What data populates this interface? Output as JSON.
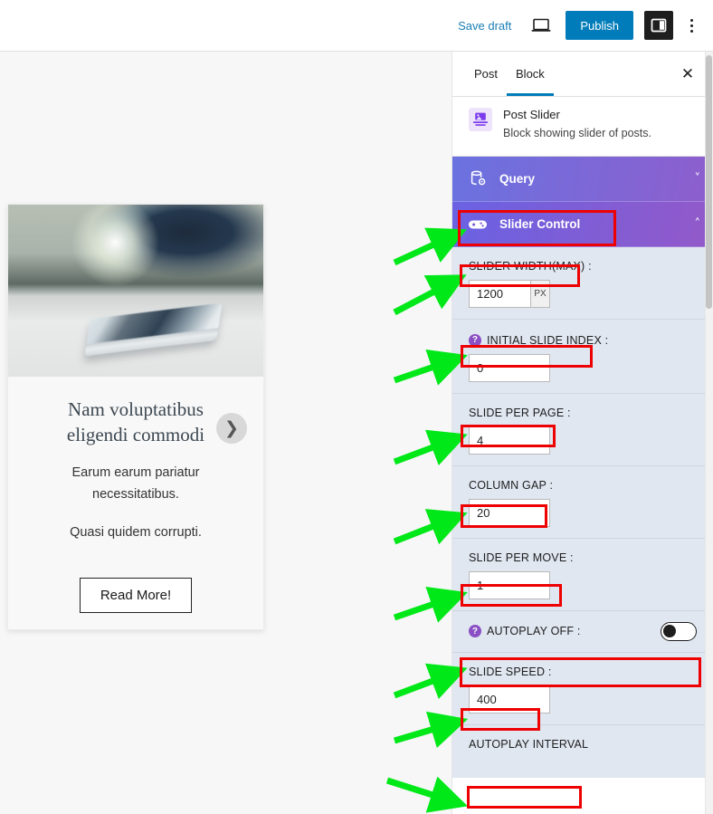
{
  "topbar": {
    "save_draft_label": "Save draft",
    "preview_icon": "laptop-preview-icon",
    "publish_label": "Publish",
    "settings_toggle_icon": "sidebar-panel-icon",
    "more_menu_icon": "three-dots-vertical-icon"
  },
  "canvas": {
    "post": {
      "thumbnail_alt": "blurred photo of silver smartphone on table",
      "title": "Nam voluptatibus eligendi commodi",
      "next_arrow_icon": "chevron-right-icon",
      "excerpt_line1": "Earum earum pariatur necessitatibus.",
      "excerpt_line2": "Quasi quidem corrupti.",
      "read_more_label": "Read More!"
    }
  },
  "sidebar": {
    "tabs": [
      {
        "label": "Post",
        "active": false
      },
      {
        "label": "Block",
        "active": true
      }
    ],
    "close_icon": "close-icon",
    "block": {
      "icon": "post-slider-block-icon",
      "name": "Post Slider",
      "description": "Block showing slider of posts."
    },
    "accordions": [
      {
        "title": "Query",
        "icon": "database-settings-icon",
        "chevron": "chevron-down-icon",
        "expanded": false
      },
      {
        "title": "Slider Control",
        "icon": "game-controller-icon",
        "chevron": "chevron-up-icon",
        "expanded": true
      }
    ],
    "fields": [
      {
        "label": "SLIDER WIDTH(MAX) :",
        "value": "1200",
        "unit": "PX",
        "help": false,
        "type": "number"
      },
      {
        "label": "INITIAL SLIDE INDEX :",
        "value": "0",
        "unit": "",
        "help": true,
        "type": "number"
      },
      {
        "label": "SLIDE PER PAGE :",
        "value": "4",
        "unit": "",
        "help": false,
        "type": "number"
      },
      {
        "label": "COLUMN GAP :",
        "value": "20",
        "unit": "",
        "help": false,
        "type": "number"
      },
      {
        "label": "SLIDE PER MOVE :",
        "value": "1",
        "unit": "",
        "help": false,
        "type": "number"
      },
      {
        "label": "AUTOPLAY OFF :",
        "value": "off",
        "unit": "",
        "help": true,
        "type": "toggle"
      },
      {
        "label": "SLIDE SPEED :",
        "value": "400",
        "unit": "",
        "help": false,
        "type": "number"
      },
      {
        "label": "AUTOPLAY INTERVAL",
        "value": "",
        "unit": "",
        "help": false,
        "type": "number"
      }
    ]
  },
  "annotations": {
    "highlight_color": "#ee0000",
    "arrow_color": "#00e818",
    "count": 9
  }
}
